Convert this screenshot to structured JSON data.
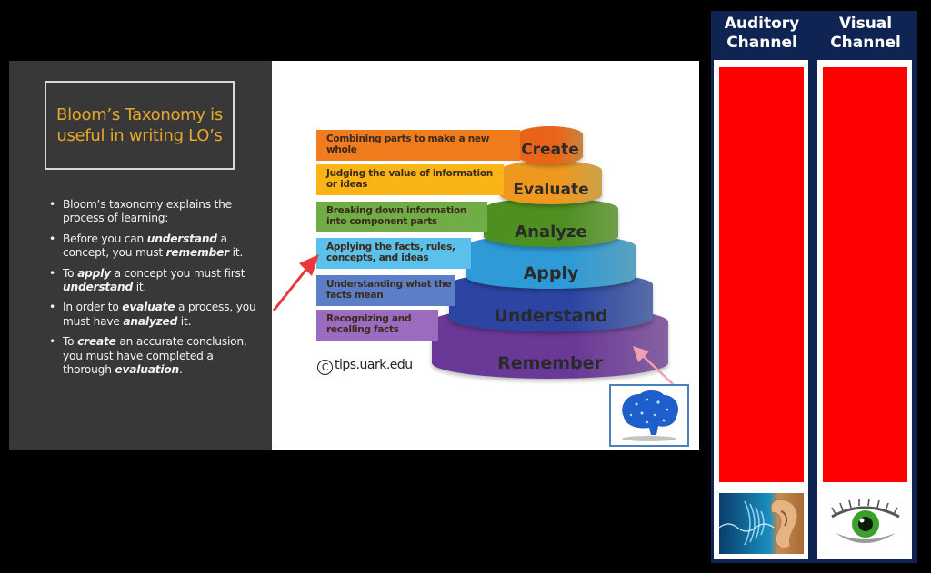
{
  "slide": {
    "title": "Bloom’s Taxonomy is useful in writing LO’s",
    "title_lines": [
      "Bloom’s Taxonomy is",
      "useful in writing LO’s"
    ],
    "bullets": [
      {
        "parts": [
          {
            "t": "Bloom’s taxonomy explains the process of learning:"
          }
        ]
      },
      {
        "parts": [
          {
            "t": "Before you can "
          },
          {
            "t": "understand",
            "em": true
          },
          {
            "t": " a concept, you must "
          },
          {
            "t": "remember",
            "em": true
          },
          {
            "t": " it."
          }
        ]
      },
      {
        "parts": [
          {
            "t": "To "
          },
          {
            "t": "apply",
            "em": true
          },
          {
            "t": " a concept you must first "
          },
          {
            "t": "understand",
            "em": true
          },
          {
            "t": " it."
          }
        ]
      },
      {
        "parts": [
          {
            "t": "In order to "
          },
          {
            "t": "evaluate",
            "em": true
          },
          {
            "t": " a process, you must have "
          },
          {
            "t": "analyzed",
            "em": true
          },
          {
            "t": " it."
          }
        ]
      },
      {
        "parts": [
          {
            "t": "To "
          },
          {
            "t": "create",
            "em": true
          },
          {
            "t": " an accurate conclusion, you must have completed a thorough "
          },
          {
            "t": "evaluation",
            "em": true
          },
          {
            "t": "."
          }
        ]
      }
    ],
    "pyramid": [
      {
        "level": "Create",
        "description": "Combining parts to make a new whole",
        "color": "#f07c1e",
        "tier_color": "#f4a04f"
      },
      {
        "level": "Evaluate",
        "description": "Judging the value of information or ideas",
        "color": "#fbb416",
        "tier_color": "#f7c55a"
      },
      {
        "level": "Analyze",
        "description": "Breaking down information into component parts",
        "color": "#70ad47",
        "tier_color": "#8cc05c"
      },
      {
        "level": "Apply",
        "description": "Applying the facts, rules, concepts, and ideas",
        "color": "#5bc0eb",
        "tier_color": "#6cc6ea"
      },
      {
        "level": "Understand",
        "description": "Understanding what the facts mean",
        "color": "#5b7fc6",
        "tier_color": "#6a85cc"
      },
      {
        "level": "Remember",
        "description": "Recognizing and recalling facts",
        "color": "#9b6bbf",
        "tier_color": "#a478c4"
      }
    ],
    "source": "tips.uark.edu",
    "brain_image": "brain-icon"
  },
  "channels": [
    {
      "label": "Auditory Channel",
      "lines": [
        "Auditory",
        "Channel"
      ],
      "bar_color": "#ff0000",
      "icon": "ear-icon"
    },
    {
      "label": "Visual Channel",
      "lines": [
        "Visual",
        "Channel"
      ],
      "bar_color": "#ff0000",
      "icon": "eye-icon"
    }
  ],
  "colors": {
    "title": "#e8a82a",
    "panel": "#383838",
    "channel_header": "#0f2452",
    "arrow": "#e8383d"
  }
}
